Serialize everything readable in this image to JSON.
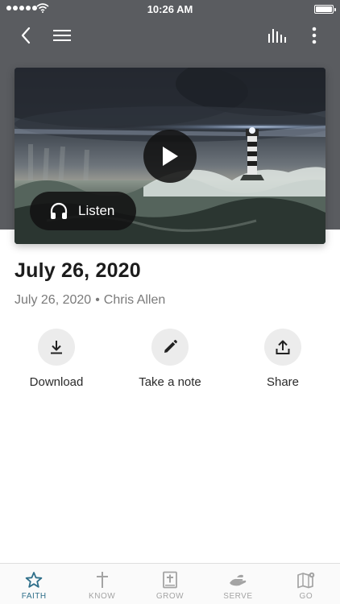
{
  "status_bar": {
    "time": "10:26 AM"
  },
  "nav": {
    "back_icon": "chevron-left-icon",
    "menu_icon": "hamburger-menu-icon",
    "bars_icon": "bar-chart-icon",
    "more_icon": "more-vertical-icon"
  },
  "media": {
    "image": "storm lighthouse ocean",
    "play_icon": "play-icon",
    "listen_label": "Listen",
    "listen_icon": "headphones-icon"
  },
  "content": {
    "title": "July 26, 2020",
    "date": "July 26, 2020",
    "separator": "•",
    "author": "Chris Allen"
  },
  "actions": [
    {
      "label": "Download",
      "icon": "download-icon"
    },
    {
      "label": "Take a note",
      "icon": "pencil-icon"
    },
    {
      "label": "Share",
      "icon": "share-icon"
    }
  ],
  "tabs": [
    {
      "label": "FAITH",
      "icon": "star-icon",
      "active": true
    },
    {
      "label": "KNOW",
      "icon": "cross-icon",
      "active": false
    },
    {
      "label": "GROW",
      "icon": "bible-icon",
      "active": false
    },
    {
      "label": "SERVE",
      "icon": "helping-hand-icon",
      "active": false
    },
    {
      "label": "GO",
      "icon": "map-icon",
      "active": false
    }
  ],
  "colors": {
    "header_band": "#5a5c60",
    "accent": "#2f6f8a",
    "inactive_tab": "#a4a4a4"
  }
}
